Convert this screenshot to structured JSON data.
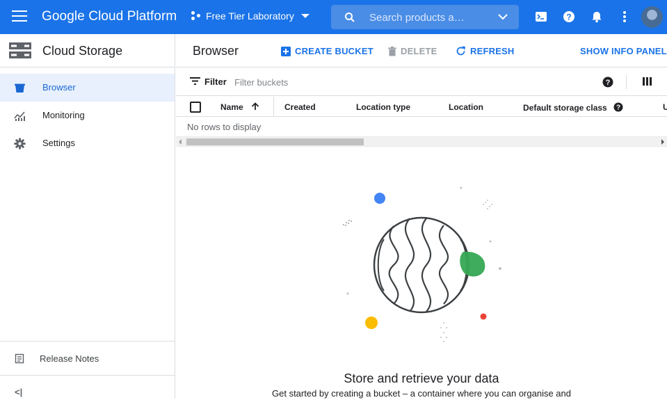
{
  "topbar": {
    "brand": "Google Cloud Platform",
    "project": "Free Tier Laboratory",
    "search_placeholder": "Search products a…",
    "accent": "#1a73e8"
  },
  "sidebar": {
    "title": "Cloud Storage",
    "items": [
      {
        "label": "Browser",
        "icon": "bucket-icon",
        "active": true
      },
      {
        "label": "Monitoring",
        "icon": "monitoring-chart-icon",
        "active": false
      },
      {
        "label": "Settings",
        "icon": "gear-icon",
        "active": false
      }
    ],
    "release_notes": "Release Notes",
    "collapse_glyph": "<|"
  },
  "toolbar": {
    "title": "Browser",
    "create_bucket": "CREATE BUCKET",
    "delete": "DELETE",
    "refresh": "REFRESH",
    "show_info_panel": "SHOW INFO PANEL"
  },
  "filter": {
    "label": "Filter",
    "placeholder": "Filter buckets"
  },
  "table": {
    "columns": [
      "Name",
      "Created",
      "Location type",
      "Location",
      "Default storage class",
      "U"
    ],
    "empty_text": "No rows to display"
  },
  "empty_state": {
    "title": "Store and retrieve your data",
    "description": "Get started by creating a bucket – a container where you can organise and"
  }
}
